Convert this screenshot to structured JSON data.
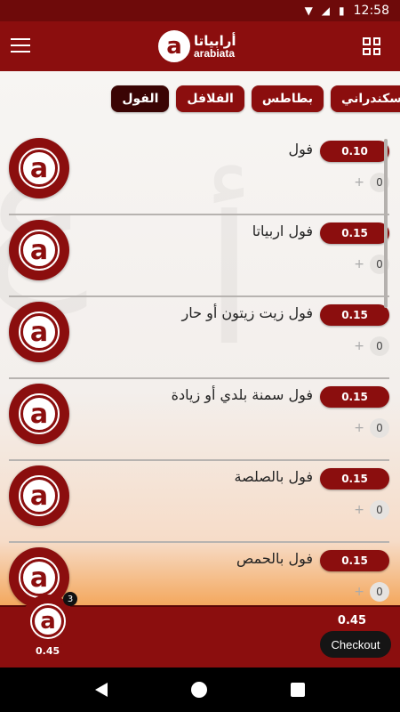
{
  "status_bar": {
    "time": "12:58"
  },
  "header": {
    "logo_ar": "أرابياتا",
    "logo_en": "arabiata",
    "logo_mark": "a"
  },
  "tabs": [
    {
      "label": "الفول",
      "active": true
    },
    {
      "label": "الفلافل",
      "active": false
    },
    {
      "label": "بطاطس",
      "active": false
    },
    {
      "label": "سكندراني",
      "active": false
    }
  ],
  "items": [
    {
      "name": "فول",
      "price": "0.10",
      "plus": "+",
      "qty": "0"
    },
    {
      "name": "فول اربياتا",
      "price": "0.15",
      "plus": "+",
      "qty": "0"
    },
    {
      "name": "فول زيت زيتون أو حار",
      "price": "0.15",
      "plus": "+",
      "qty": "0"
    },
    {
      "name": "فول سمنة بلدي أو زيادة",
      "price": "0.15",
      "plus": "+",
      "qty": "0"
    },
    {
      "name": "فول بالصلصة",
      "price": "0.15",
      "plus": "+",
      "qty": "0"
    },
    {
      "name": "فول بالحمص",
      "price": "0.15",
      "plus": "+",
      "qty": "0"
    }
  ],
  "cart": {
    "badge": "3",
    "total_left": "0.45",
    "total_right": "0.45",
    "checkout_label": "Checkout"
  },
  "colors": {
    "primary": "#8b0e0e",
    "dark": "#3a0404",
    "status": "#6e0a0a"
  }
}
